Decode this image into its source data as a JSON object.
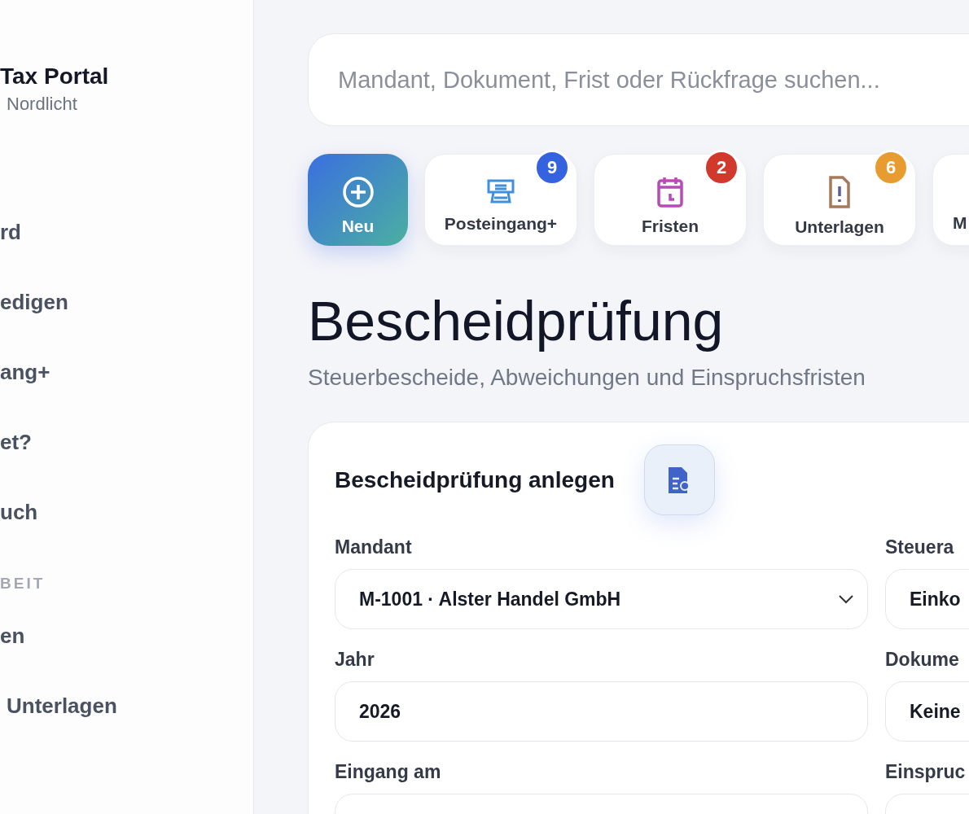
{
  "sidebar": {
    "brand": "Tax Portal",
    "subtitle": "Nordlicht",
    "items": [
      {
        "label": "rd"
      },
      {
        "label": "edigen"
      },
      {
        "label": "ang+"
      },
      {
        "label": "et?"
      },
      {
        "label": "uch"
      }
    ],
    "section": {
      "title": "BEIT",
      "items": [
        {
          "label": "en"
        },
        {
          "label": "Unterlagen"
        }
      ]
    }
  },
  "search": {
    "placeholder": "Mandant, Dokument, Frist oder Rückfrage suchen..."
  },
  "quick_actions": [
    {
      "kind": "new",
      "label": "Neu"
    },
    {
      "kind": "inbox",
      "label": "Posteingang+",
      "badge": "9",
      "color": "#3563e0"
    },
    {
      "kind": "deadline",
      "label": "Fristen",
      "badge": "2",
      "color": "#d0392b"
    },
    {
      "kind": "documents",
      "label": "Unterlagen",
      "badge": "6",
      "color": "#e89b2e"
    },
    {
      "kind": "other",
      "label": "M"
    }
  ],
  "page": {
    "title": "Bescheidprüfung",
    "subtitle": "Steuerbescheide, Abweichungen und Einspruchsfristen"
  },
  "card": {
    "title": "Bescheidprüfung anlegen",
    "fields": [
      {
        "label": "Mandant",
        "kind": "select",
        "value": "M-1001 · Alster Handel GmbH"
      },
      {
        "label": "Steuera",
        "kind": "select",
        "value": "Einko"
      },
      {
        "label": "Jahr",
        "kind": "input",
        "value": "2026"
      },
      {
        "label": "Dokume",
        "kind": "select",
        "value": "Keine"
      },
      {
        "label": "Eingang am",
        "kind": "input"
      },
      {
        "label": "Einspruc",
        "kind": "input"
      }
    ]
  }
}
